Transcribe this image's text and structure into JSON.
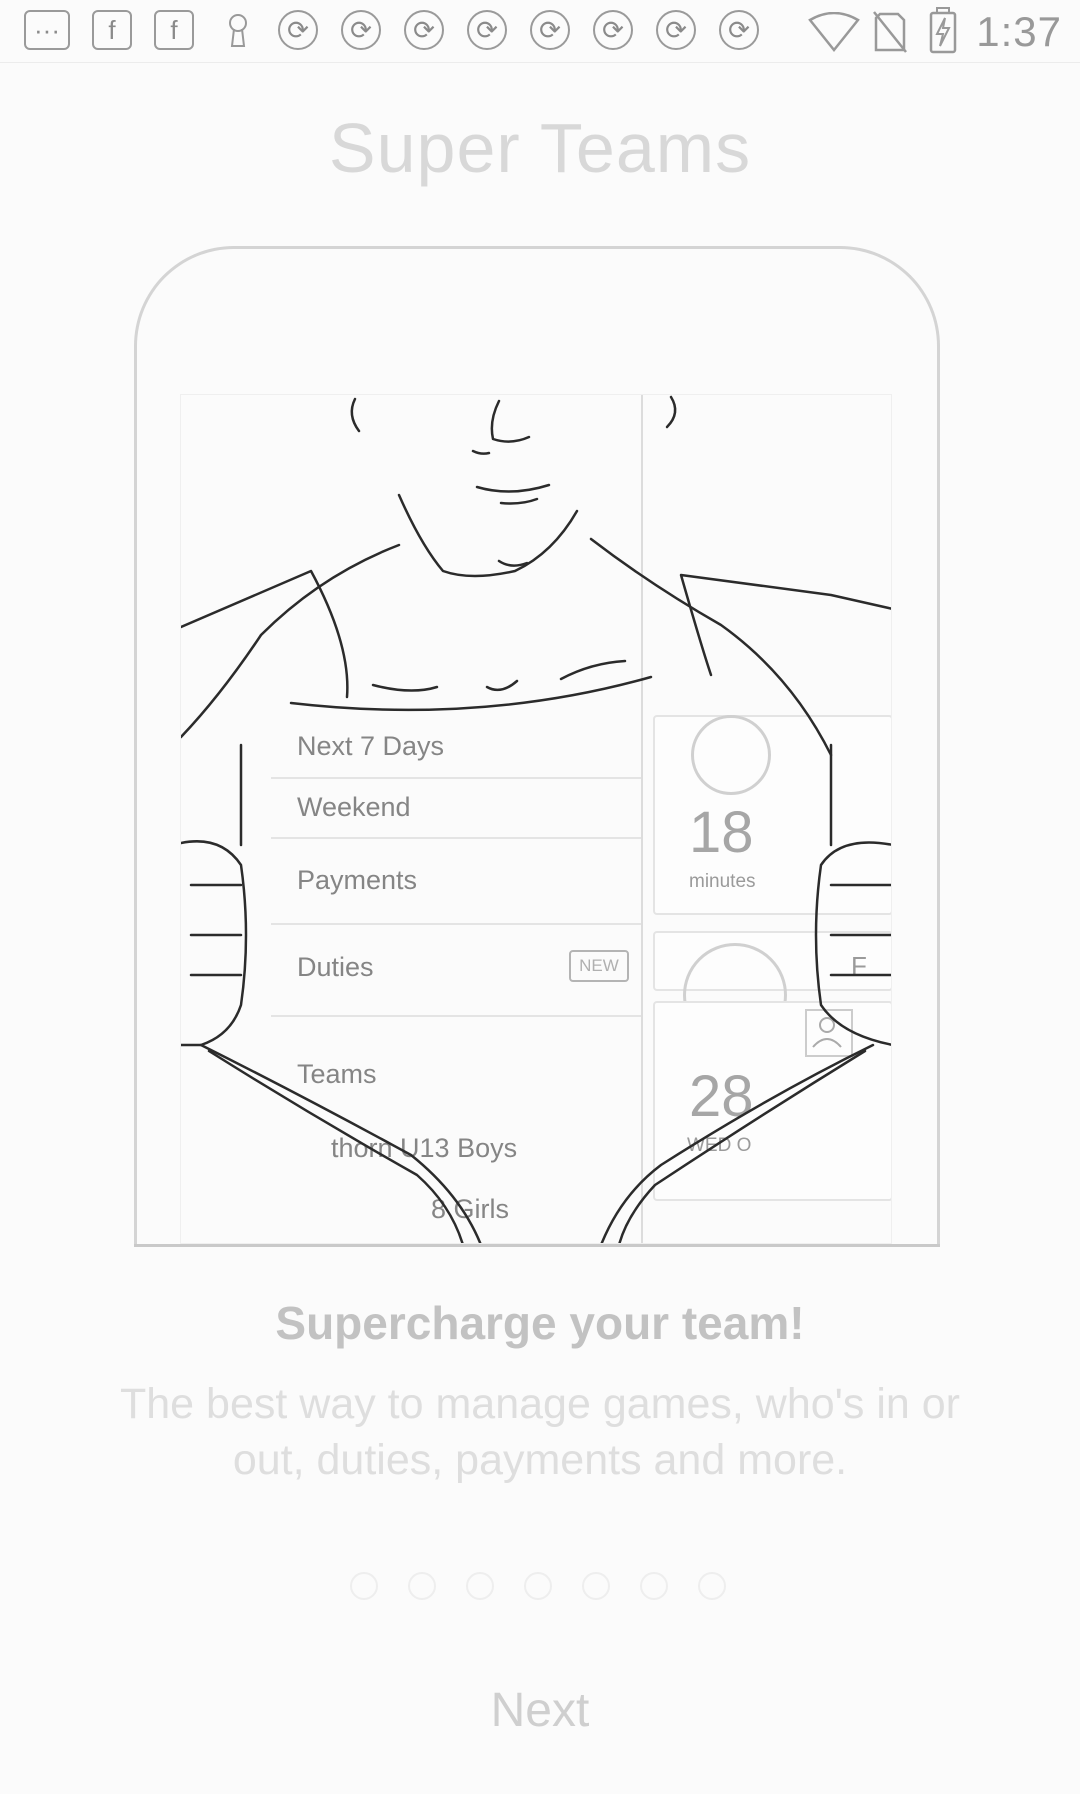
{
  "status_bar": {
    "time": "1:37",
    "left_icons": [
      "chat-icon",
      "facebook-icon",
      "facebook-icon",
      "keyhole-icon",
      "sync-icon",
      "sync-icon",
      "sync-icon",
      "sync-icon",
      "sync-icon",
      "sync-icon",
      "sync-icon",
      "sync-icon"
    ],
    "right_icons": [
      "wifi-icon",
      "no-sim-icon",
      "battery-charging-icon"
    ]
  },
  "title": "Super Teams",
  "preview": {
    "menu": [
      {
        "label": "Next 7 Days"
      },
      {
        "label": "Weekend"
      },
      {
        "label": "Payments"
      },
      {
        "label": "Duties",
        "badge": "NEW"
      },
      {
        "label": "Teams"
      },
      {
        "label": "thorn U13 Boys"
      },
      {
        "label": "8 Girls"
      }
    ],
    "cards": [
      {
        "value": "18",
        "label": "minutes"
      },
      {
        "value": "28",
        "label": "WED O"
      }
    ],
    "partial_letter": "F"
  },
  "subtitle": "Supercharge your team!",
  "description": "The best way to manage games, who's in or out, duties, payments and more.",
  "pager": {
    "count": 7,
    "active_index": 0
  },
  "next_label": "Next"
}
